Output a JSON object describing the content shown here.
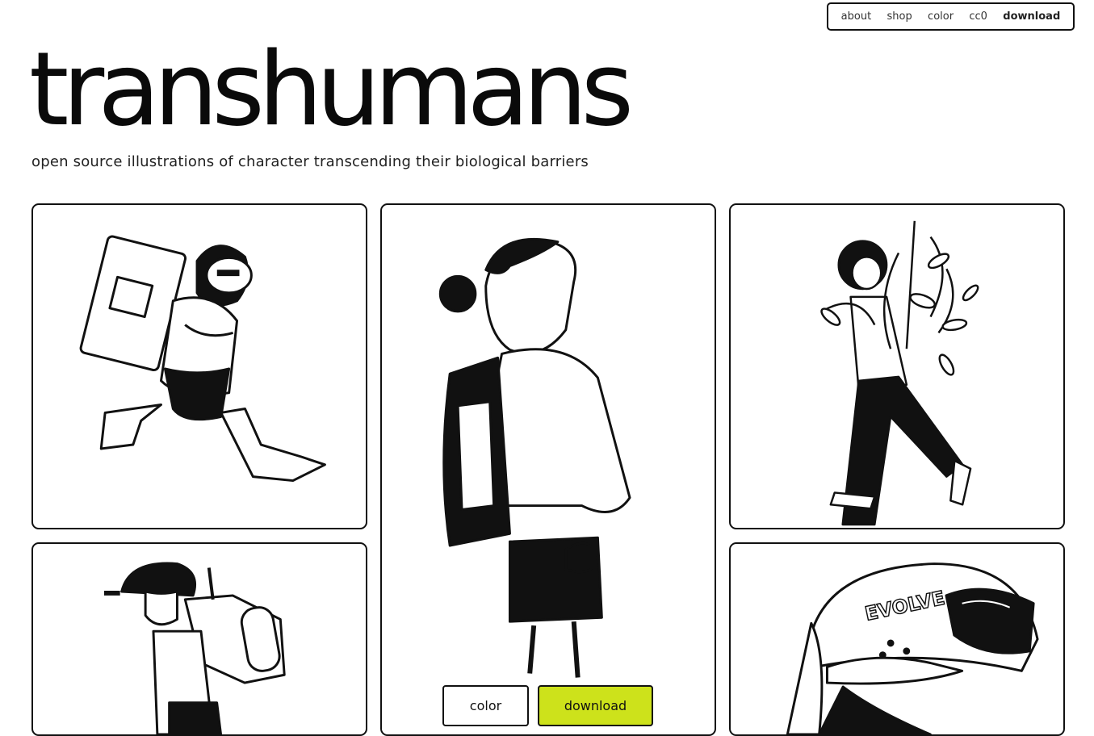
{
  "nav": {
    "items": [
      "about",
      "shop",
      "color",
      "cc0"
    ],
    "download": "download"
  },
  "hero": {
    "title": "transhumans",
    "subtitle": "open source illustrations of character transcending their biological barriers"
  },
  "illustration_text": {
    "helmet": "EVOLVE"
  },
  "actions": {
    "color_label": "color",
    "download_label": "download",
    "accent": "#cde21b"
  }
}
